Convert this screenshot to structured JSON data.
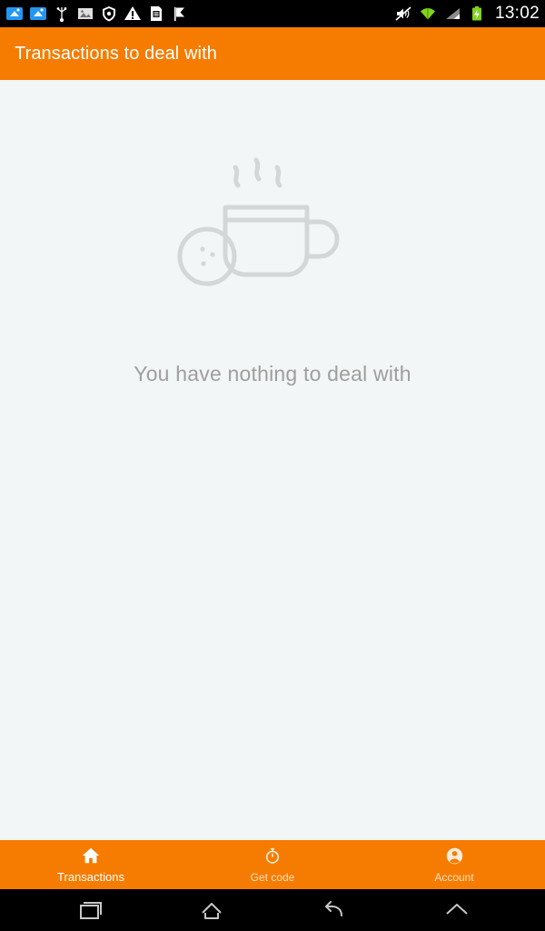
{
  "statusbar": {
    "left_icons": [
      {
        "name": "download-manager-icon",
        "label": "download"
      },
      {
        "name": "download-manager-icon-2",
        "label": "download"
      },
      {
        "name": "usb-debugging-icon",
        "label": "usb"
      },
      {
        "name": "screenshot-image-icon",
        "label": "image"
      },
      {
        "name": "shield-icon",
        "label": "security"
      },
      {
        "name": "warning-icon",
        "label": "warning"
      },
      {
        "name": "sim-card-icon",
        "label": "sim"
      },
      {
        "name": "flag-icon",
        "label": "flag"
      }
    ],
    "right_icons": [
      {
        "name": "mute-volume-icon",
        "label": "silent"
      },
      {
        "name": "wifi-icon",
        "label": "wifi"
      },
      {
        "name": "cellular-signal-icon",
        "label": "signal"
      },
      {
        "name": "battery-icon",
        "label": "battery"
      }
    ],
    "clock": "13:02"
  },
  "appbar": {
    "title": "Transactions to deal with"
  },
  "content": {
    "illustration": "coffee-cup-and-cookie-icon",
    "empty_message": "You have nothing to deal with"
  },
  "bottom_nav": {
    "items": [
      {
        "label": "Transactions",
        "icon": "home-icon",
        "active": true
      },
      {
        "label": "Get code",
        "icon": "stopwatch-icon",
        "active": false
      },
      {
        "label": "Account",
        "icon": "person-icon",
        "active": false
      }
    ]
  },
  "system_nav": {
    "buttons": [
      {
        "name": "recent-apps-button",
        "label": "Recent apps"
      },
      {
        "name": "home-button",
        "label": "Home"
      },
      {
        "name": "back-button",
        "label": "Back"
      },
      {
        "name": "expand-button",
        "label": "Expand"
      }
    ]
  },
  "colors": {
    "accent": "#f57c00",
    "background": "#f2f6f6",
    "muted_text": "#9e9e9e",
    "statusbar": "#000000"
  }
}
